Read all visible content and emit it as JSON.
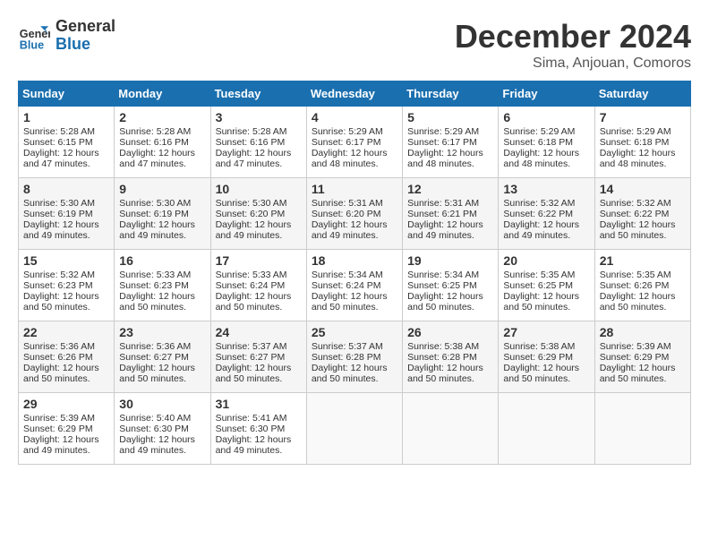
{
  "header": {
    "logo_line1": "General",
    "logo_line2": "Blue",
    "month": "December 2024",
    "location": "Sima, Anjouan, Comoros"
  },
  "days_of_week": [
    "Sunday",
    "Monday",
    "Tuesday",
    "Wednesday",
    "Thursday",
    "Friday",
    "Saturday"
  ],
  "weeks": [
    [
      {
        "day": "1",
        "info": "Sunrise: 5:28 AM\nSunset: 6:15 PM\nDaylight: 12 hours\nand 47 minutes."
      },
      {
        "day": "2",
        "info": "Sunrise: 5:28 AM\nSunset: 6:16 PM\nDaylight: 12 hours\nand 47 minutes."
      },
      {
        "day": "3",
        "info": "Sunrise: 5:28 AM\nSunset: 6:16 PM\nDaylight: 12 hours\nand 47 minutes."
      },
      {
        "day": "4",
        "info": "Sunrise: 5:29 AM\nSunset: 6:17 PM\nDaylight: 12 hours\nand 48 minutes."
      },
      {
        "day": "5",
        "info": "Sunrise: 5:29 AM\nSunset: 6:17 PM\nDaylight: 12 hours\nand 48 minutes."
      },
      {
        "day": "6",
        "info": "Sunrise: 5:29 AM\nSunset: 6:18 PM\nDaylight: 12 hours\nand 48 minutes."
      },
      {
        "day": "7",
        "info": "Sunrise: 5:29 AM\nSunset: 6:18 PM\nDaylight: 12 hours\nand 48 minutes."
      }
    ],
    [
      {
        "day": "8",
        "info": "Sunrise: 5:30 AM\nSunset: 6:19 PM\nDaylight: 12 hours\nand 49 minutes."
      },
      {
        "day": "9",
        "info": "Sunrise: 5:30 AM\nSunset: 6:19 PM\nDaylight: 12 hours\nand 49 minutes."
      },
      {
        "day": "10",
        "info": "Sunrise: 5:30 AM\nSunset: 6:20 PM\nDaylight: 12 hours\nand 49 minutes."
      },
      {
        "day": "11",
        "info": "Sunrise: 5:31 AM\nSunset: 6:20 PM\nDaylight: 12 hours\nand 49 minutes."
      },
      {
        "day": "12",
        "info": "Sunrise: 5:31 AM\nSunset: 6:21 PM\nDaylight: 12 hours\nand 49 minutes."
      },
      {
        "day": "13",
        "info": "Sunrise: 5:32 AM\nSunset: 6:22 PM\nDaylight: 12 hours\nand 49 minutes."
      },
      {
        "day": "14",
        "info": "Sunrise: 5:32 AM\nSunset: 6:22 PM\nDaylight: 12 hours\nand 50 minutes."
      }
    ],
    [
      {
        "day": "15",
        "info": "Sunrise: 5:32 AM\nSunset: 6:23 PM\nDaylight: 12 hours\nand 50 minutes."
      },
      {
        "day": "16",
        "info": "Sunrise: 5:33 AM\nSunset: 6:23 PM\nDaylight: 12 hours\nand 50 minutes."
      },
      {
        "day": "17",
        "info": "Sunrise: 5:33 AM\nSunset: 6:24 PM\nDaylight: 12 hours\nand 50 minutes."
      },
      {
        "day": "18",
        "info": "Sunrise: 5:34 AM\nSunset: 6:24 PM\nDaylight: 12 hours\nand 50 minutes."
      },
      {
        "day": "19",
        "info": "Sunrise: 5:34 AM\nSunset: 6:25 PM\nDaylight: 12 hours\nand 50 minutes."
      },
      {
        "day": "20",
        "info": "Sunrise: 5:35 AM\nSunset: 6:25 PM\nDaylight: 12 hours\nand 50 minutes."
      },
      {
        "day": "21",
        "info": "Sunrise: 5:35 AM\nSunset: 6:26 PM\nDaylight: 12 hours\nand 50 minutes."
      }
    ],
    [
      {
        "day": "22",
        "info": "Sunrise: 5:36 AM\nSunset: 6:26 PM\nDaylight: 12 hours\nand 50 minutes."
      },
      {
        "day": "23",
        "info": "Sunrise: 5:36 AM\nSunset: 6:27 PM\nDaylight: 12 hours\nand 50 minutes."
      },
      {
        "day": "24",
        "info": "Sunrise: 5:37 AM\nSunset: 6:27 PM\nDaylight: 12 hours\nand 50 minutes."
      },
      {
        "day": "25",
        "info": "Sunrise: 5:37 AM\nSunset: 6:28 PM\nDaylight: 12 hours\nand 50 minutes."
      },
      {
        "day": "26",
        "info": "Sunrise: 5:38 AM\nSunset: 6:28 PM\nDaylight: 12 hours\nand 50 minutes."
      },
      {
        "day": "27",
        "info": "Sunrise: 5:38 AM\nSunset: 6:29 PM\nDaylight: 12 hours\nand 50 minutes."
      },
      {
        "day": "28",
        "info": "Sunrise: 5:39 AM\nSunset: 6:29 PM\nDaylight: 12 hours\nand 50 minutes."
      }
    ],
    [
      {
        "day": "29",
        "info": "Sunrise: 5:39 AM\nSunset: 6:29 PM\nDaylight: 12 hours\nand 49 minutes."
      },
      {
        "day": "30",
        "info": "Sunrise: 5:40 AM\nSunset: 6:30 PM\nDaylight: 12 hours\nand 49 minutes."
      },
      {
        "day": "31",
        "info": "Sunrise: 5:41 AM\nSunset: 6:30 PM\nDaylight: 12 hours\nand 49 minutes."
      },
      {
        "day": "",
        "info": ""
      },
      {
        "day": "",
        "info": ""
      },
      {
        "day": "",
        "info": ""
      },
      {
        "day": "",
        "info": ""
      }
    ]
  ]
}
